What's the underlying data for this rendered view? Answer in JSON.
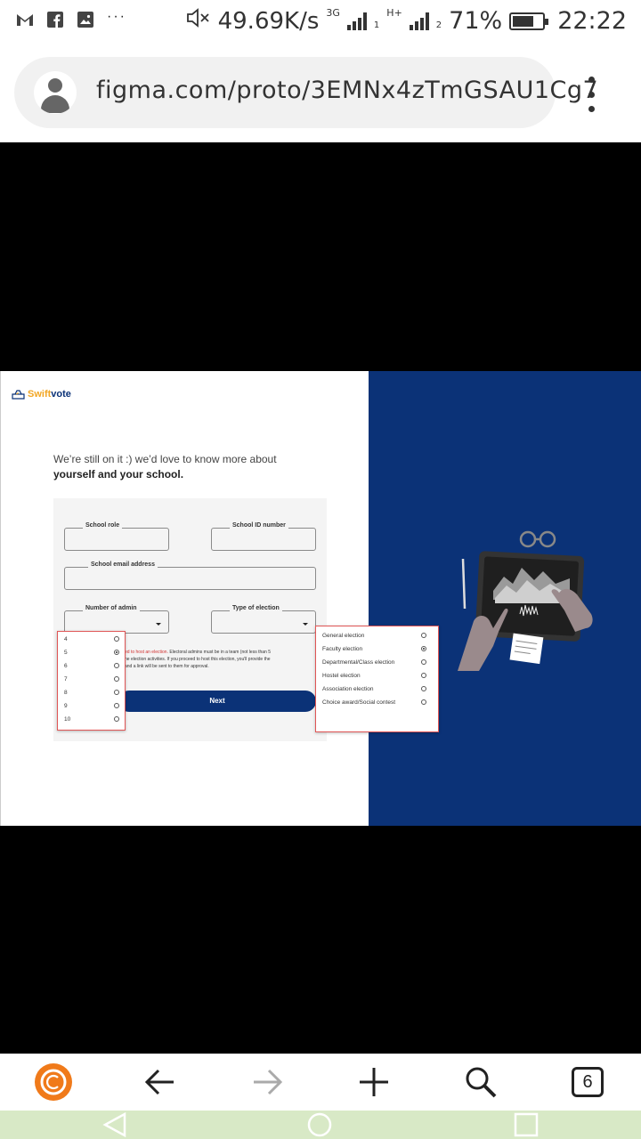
{
  "status_bar": {
    "network_speed": "49.69K/s",
    "net_type_1": "3G",
    "net_type_2": "H+",
    "sim_1": "1",
    "sim_2": "2",
    "battery": "71%",
    "time": "22:22",
    "icons": [
      "gmail-icon",
      "facebook-icon",
      "gallery-icon",
      "more-dots-icon",
      "mute-icon",
      "signal-icon",
      "battery-icon"
    ]
  },
  "browser": {
    "url": "figma.com/proto/3EMNx4zTmGSAU1Cg7",
    "tab_count": "6"
  },
  "app": {
    "brand_part1": "Swift",
    "brand_part2": "vote",
    "intro_line": "We’re still on it :) we’d love to know more about",
    "intro_strong": "yourself and your school.",
    "fields": {
      "school_role": "School role",
      "school_id": "School ID number",
      "school_email": "School email address",
      "number_of_admin": "Number of admin",
      "type_of_election": "Type of election"
    },
    "notice_red": "ed to host an election.",
    "notice_rest": " Electoral admins must be in a team (not less than 5",
    "notice_line2": "he election activities. If you proceed to host this election, you'll provide the",
    "notice_line3": "and a link will be sent to them for approval.",
    "next_label": "Next",
    "admin_options": [
      "4",
      "5",
      "6",
      "7",
      "8",
      "9",
      "10"
    ],
    "admin_selected": "5",
    "election_options": [
      "General election",
      "Faculty election",
      "Departmental/Class election",
      "Hostel election",
      "Association election",
      "Choice award/Social contest"
    ],
    "election_selected": "Faculty election"
  },
  "colors": {
    "brand_navy": "#0b3277",
    "brand_orange": "#f2a623",
    "error_red": "#d0302f"
  }
}
